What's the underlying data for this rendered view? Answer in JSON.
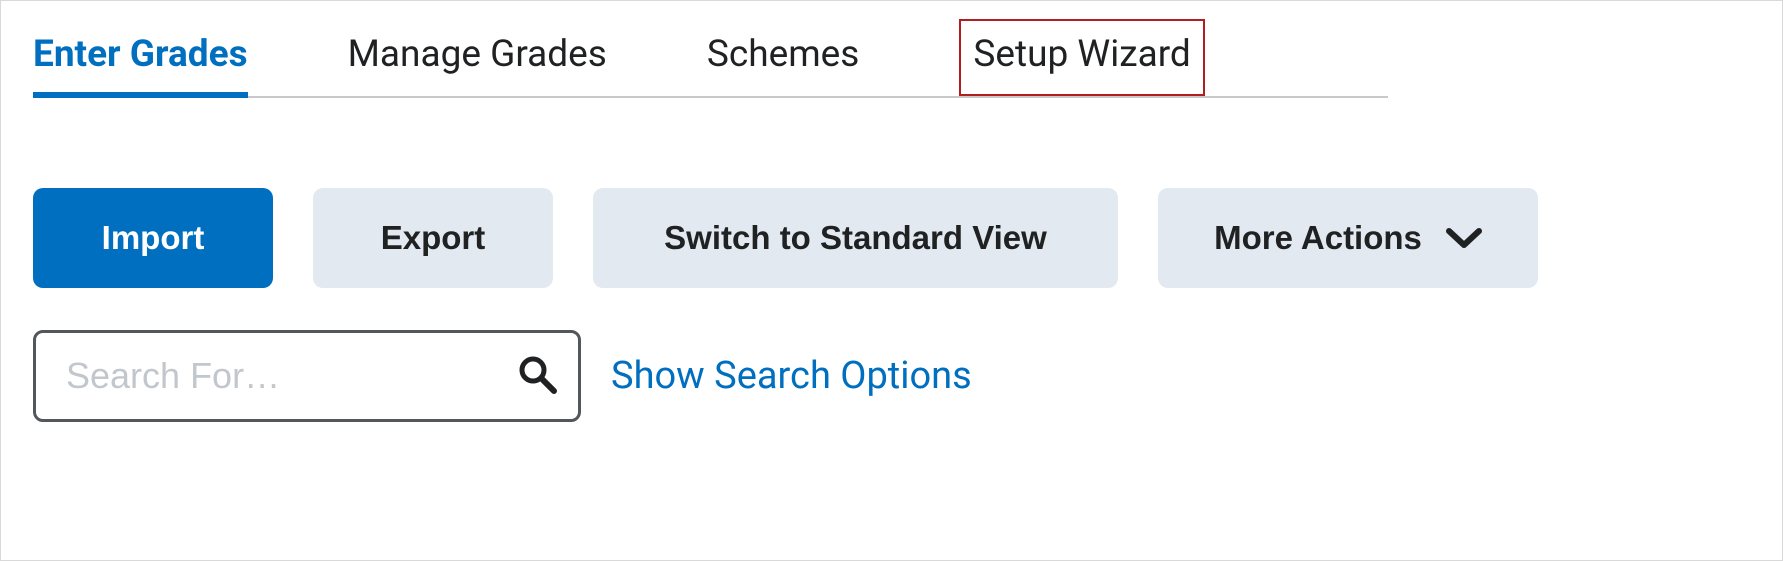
{
  "tabs": {
    "enter_grades": "Enter Grades",
    "manage_grades": "Manage Grades",
    "schemes": "Schemes",
    "setup_wizard": "Setup Wizard"
  },
  "actions": {
    "import": "Import",
    "export": "Export",
    "switch_view": "Switch to Standard View",
    "more_actions": "More Actions"
  },
  "search": {
    "placeholder": "Search For…",
    "value": "",
    "show_options": "Show Search Options"
  }
}
